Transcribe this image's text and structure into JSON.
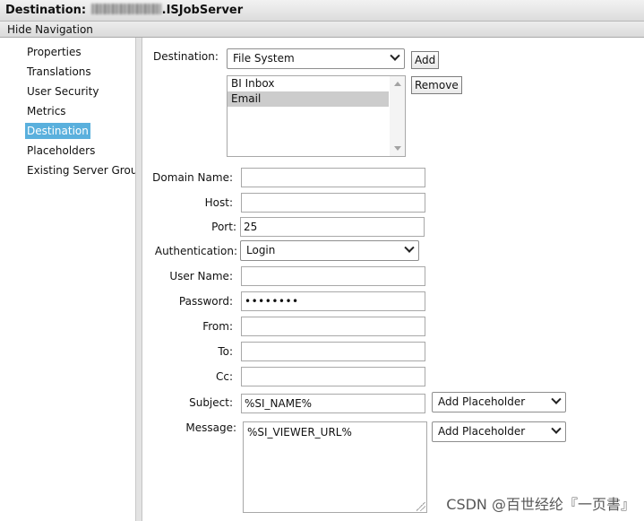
{
  "window": {
    "title_prefix": "Destination:",
    "title_suffix": ".ISJobServer"
  },
  "navigation": {
    "hide_label": "Hide Navigation"
  },
  "sidebar": {
    "items": [
      {
        "label": "Properties"
      },
      {
        "label": "Translations"
      },
      {
        "label": "User Security"
      },
      {
        "label": "Metrics"
      },
      {
        "label": "Destination",
        "active": true
      },
      {
        "label": "Placeholders"
      },
      {
        "label": "Existing Server Group"
      }
    ]
  },
  "form": {
    "destination": {
      "label": "Destination:",
      "selected": "File System",
      "add_label": "Add",
      "remove_label": "Remove",
      "list": [
        "BI Inbox",
        "Email"
      ],
      "list_selected": "Email"
    },
    "domain_name": {
      "label": "Domain Name:",
      "value": ""
    },
    "host": {
      "label": "Host:",
      "value": ""
    },
    "port": {
      "label": "Port:",
      "value": "25"
    },
    "authentication": {
      "label": "Authentication:",
      "selected": "Login"
    },
    "user_name": {
      "label": "User Name:",
      "value": ""
    },
    "password": {
      "label": "Password:",
      "value": "••••••••"
    },
    "from": {
      "label": "From:",
      "value": ""
    },
    "to": {
      "label": "To:",
      "value": ""
    },
    "cc": {
      "label": "Cc:",
      "value": ""
    },
    "subject": {
      "label": "Subject:",
      "value": "%SI_NAME%",
      "placeholder_select": "Add Placeholder"
    },
    "message": {
      "label": "Message:",
      "value": "%SI_VIEWER_URL%",
      "placeholder_select": "Add Placeholder"
    }
  },
  "watermark": {
    "text": "CSDN @百世经纶『一页書』"
  },
  "icons": {
    "dropdown": "chevron-down-icon",
    "scroll": "scroll-arrow-icon"
  }
}
